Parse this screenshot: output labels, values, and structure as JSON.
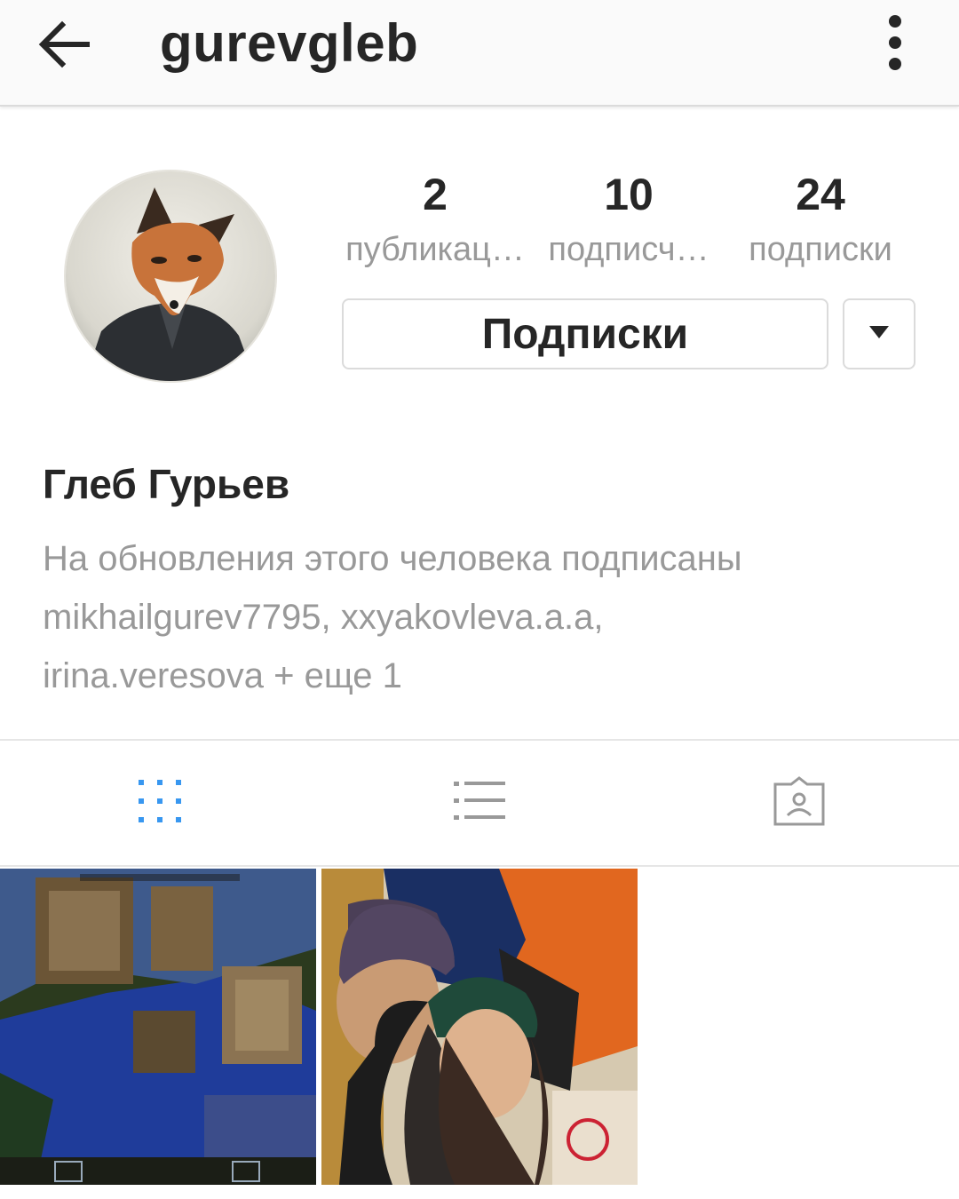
{
  "header": {
    "username": "gurevgleb",
    "back_icon": "arrow-left-icon",
    "more_icon": "kebab-menu-icon"
  },
  "profile": {
    "stats": [
      {
        "value": "2",
        "label": "публикац…"
      },
      {
        "value": "10",
        "label": "подписч…"
      },
      {
        "value": "24",
        "label": "подписки"
      }
    ],
    "follow_button_label": "Подписки",
    "dropdown_icon": "caret-down-icon",
    "full_name": "Глеб Гурьев",
    "followed_by_line1": "На обновления этого человека подписаны",
    "followed_by_line2": "mikhailgurev7795, xxyakovleva.a.a,",
    "followed_by_line3": "irina.veresova + еще 1"
  },
  "tabs": [
    {
      "icon": "grid-view-icon",
      "active": true
    },
    {
      "icon": "list-view-icon",
      "active": false
    },
    {
      "icon": "tagged-photos-icon",
      "active": false
    }
  ],
  "colors": {
    "accent": "#3897f0",
    "secondary_text": "#999999",
    "border": "#dbdbdb"
  }
}
